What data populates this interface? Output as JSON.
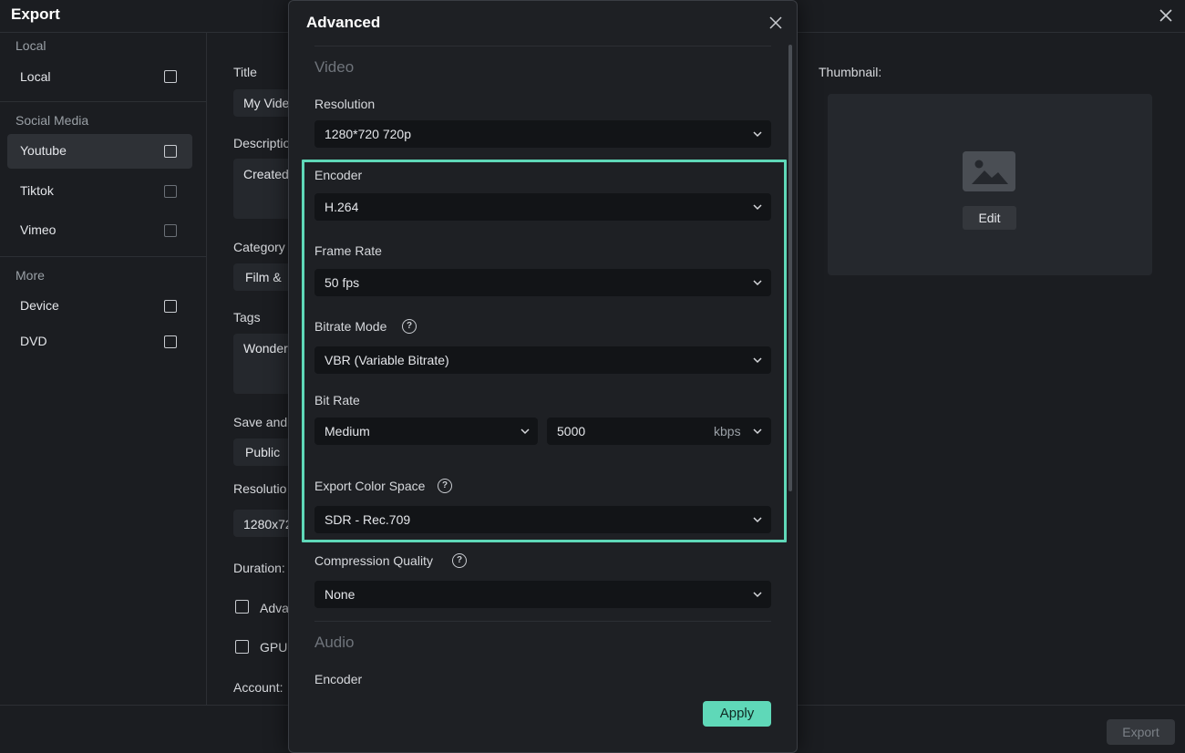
{
  "window": {
    "title": "Export"
  },
  "sidebar": {
    "sections": [
      "Local",
      "Social Media",
      "More"
    ],
    "items": [
      {
        "label": "Local"
      },
      {
        "label": "Youtube"
      },
      {
        "label": "Tiktok"
      },
      {
        "label": "Vimeo"
      },
      {
        "label": "Device"
      },
      {
        "label": "DVD"
      }
    ]
  },
  "form": {
    "title_label": "Title",
    "title_value": "My Vide",
    "description_label": "Descriptio",
    "description_value": "Created",
    "category_label": "Category",
    "category_value": "Film &",
    "tags_label": "Tags",
    "tags_value": "Wonder",
    "save_label": "Save and",
    "save_value": "Public",
    "resolution_label": "Resolutio",
    "resolution_value": "1280x72",
    "duration_label": "Duration:",
    "advanced_option": "Adva",
    "gpu_option": "GPU",
    "account_label": "Account:"
  },
  "thumbnail": {
    "label": "Thumbnail:",
    "edit_label": "Edit",
    "icon": "image-icon"
  },
  "footer": {
    "export_label": "Export"
  },
  "modal": {
    "title": "Advanced",
    "video_section": "Video",
    "resolution": {
      "label": "Resolution",
      "value": "1280*720 720p"
    },
    "encoder": {
      "label": "Encoder",
      "value": "H.264"
    },
    "frame_rate": {
      "label": "Frame Rate",
      "value": "50 fps"
    },
    "bitrate_mode": {
      "label": "Bitrate Mode",
      "value": "VBR (Variable Bitrate)"
    },
    "bit_rate": {
      "label": "Bit Rate",
      "preset": "Medium",
      "value": "5000",
      "unit": "kbps"
    },
    "color_space": {
      "label": "Export Color Space",
      "value": "SDR - Rec.709"
    },
    "compression": {
      "label": "Compression Quality",
      "value": "None"
    },
    "audio_section": "Audio",
    "audio_encoder_label": "Encoder",
    "apply_label": "Apply",
    "help_glyph": "?"
  },
  "colors": {
    "accent": "#5fd8b8",
    "background": "#1b1d21",
    "field": "#121417"
  }
}
